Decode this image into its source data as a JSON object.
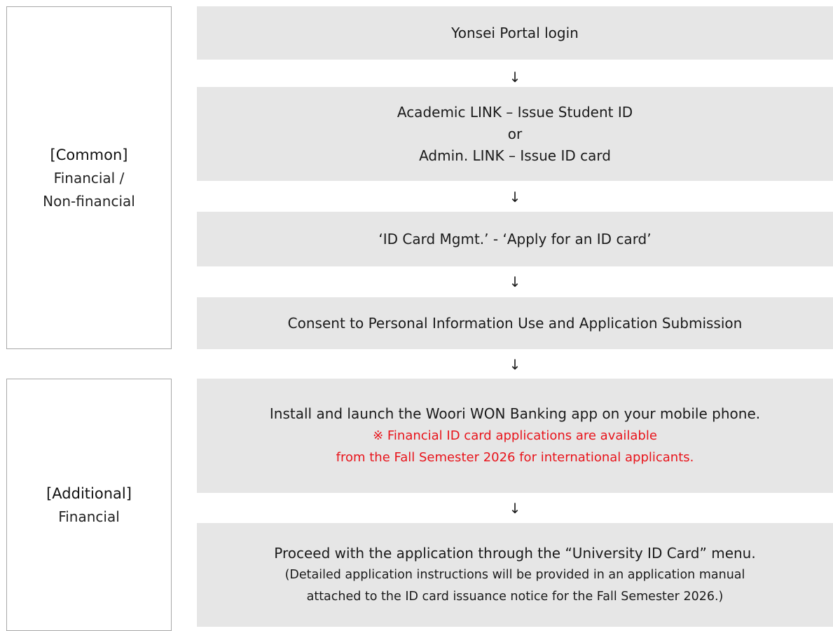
{
  "sections": {
    "common": {
      "title": "[Common]",
      "line1": "Financial /",
      "line2": "Non-financial"
    },
    "additional": {
      "title": "[Additional]",
      "line1": "Financial"
    }
  },
  "arrow_glyph": "↓",
  "steps": {
    "portal_login": "Yonsei Portal login",
    "academic_link": "Academic LINK – Issue Student ID",
    "or": "or",
    "admin_link": "Admin. LINK – Issue ID card",
    "id_card_mgmt": "‘ID Card Mgmt.’ - ‘Apply for an ID card’",
    "consent": "Consent to Personal Information Use and Application Submission",
    "install_app": "Install and launch the Woori WON Banking app on your mobile phone.",
    "notice_line1": "※ Financial ID card applications are available",
    "notice_line2": "from the Fall Semester 2026 for international applicants.",
    "proceed": "Proceed with the application through the “University ID Card” menu.",
    "detail_line1": "(Detailed application instructions will be provided in an application manual",
    "detail_line2": "attached to the ID card issuance notice for the Fall Semester 2026.)"
  },
  "colors": {
    "step_bg": "#e6e6e6",
    "border": "#a8a8a8",
    "notice": "#e8141b"
  }
}
